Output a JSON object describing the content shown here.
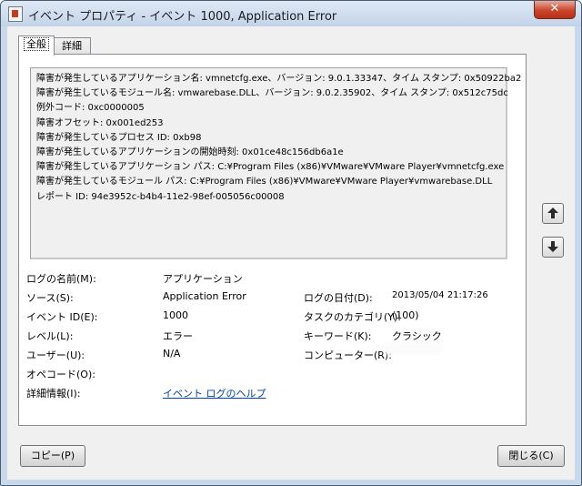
{
  "window": {
    "title": "イベント プロパティ - イベント 1000, Application Error",
    "close_glyph": "✕"
  },
  "tabs": [
    {
      "label": "全般",
      "active": true
    },
    {
      "label": "詳細",
      "active": false
    }
  ],
  "description_lines": [
    "障害が発生しているアプリケーション名: vmnetcfg.exe、バージョン: 9.0.1.33347、タイム スタンプ: 0x50922ba2",
    "障害が発生しているモジュール名: vmwarebase.DLL、バージョン: 9.0.2.35902、タイム スタンプ: 0x512c75dc",
    "例外コード: 0xc0000005",
    "障害オフセット: 0x001ed253",
    "障害が発生しているプロセス ID: 0xb98",
    "障害が発生しているアプリケーションの開始時刻: 0x01ce48c156db6a1e",
    "障害が発生しているアプリケーション パス: C:¥Program Files (x86)¥VMware¥VMware Player¥vmnetcfg.exe",
    "障害が発生しているモジュール パス: C:¥Program Files (x86)¥VMware¥VMware Player¥vmwarebase.DLL",
    "レポート ID: 94e3952c-b4b4-11e2-98ef-005056c00008"
  ],
  "fields": {
    "log_name": {
      "label": "ログの名前(M):",
      "value": "アプリケーション"
    },
    "source": {
      "label": "ソース(S):",
      "value": "Application Error"
    },
    "logged": {
      "label": "ログの日付(D):",
      "value": "2013/05/04 21:17:26"
    },
    "event_id": {
      "label": "イベント ID(E):",
      "value": "1000"
    },
    "task_category": {
      "label": "タスクのカテゴリ(Y):",
      "value": "(100)"
    },
    "level": {
      "label": "レベル(L):",
      "value": "エラー"
    },
    "keywords": {
      "label": "キーワード(K):",
      "value": "クラシック"
    },
    "user": {
      "label": "ユーザー(U):",
      "value": "N/A"
    },
    "computer": {
      "label": "コンピューター(R):",
      "value": ""
    },
    "opcode": {
      "label": "オペコード(O):",
      "value": ""
    },
    "more_info": {
      "label": "詳細情報(I):",
      "link": "イベント ログのヘルプ"
    }
  },
  "buttons": {
    "copy": "コピー(P)",
    "close": "閉じる(C)"
  },
  "icons": {
    "app": "event-viewer-icon",
    "up": "arrow-up-icon",
    "down": "arrow-down-icon"
  }
}
